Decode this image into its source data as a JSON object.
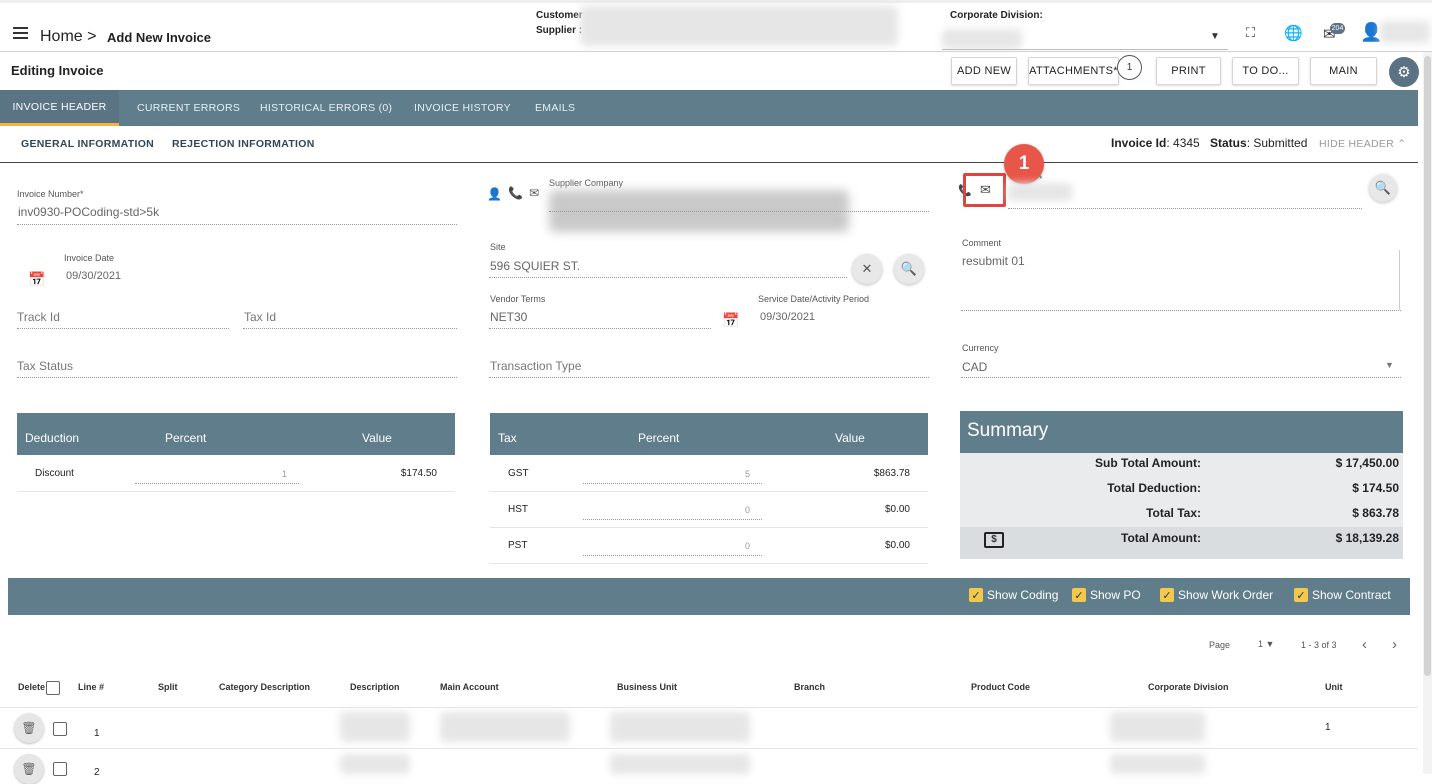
{
  "header": {
    "home": "Home >",
    "page": "Add New Invoice",
    "customer_label": "Customer",
    "supplier_label": "Supplier :",
    "corporate_division_label": "Corporate Division:",
    "notification_count": "204"
  },
  "toolbar": {
    "title": "Editing Invoice",
    "buttons": [
      "ADD NEW",
      "ATTACHMENTS*",
      "PRINT",
      "TO DO...",
      "MAIN"
    ],
    "attachments_count": "1"
  },
  "tabs": [
    "INVOICE HEADER",
    "CURRENT ERRORS",
    "HISTORICAL ERRORS (0)",
    "INVOICE HISTORY",
    "EMAILS"
  ],
  "subtabs": [
    "GENERAL INFORMATION",
    "REJECTION INFORMATION"
  ],
  "invoice_meta": {
    "id_label": "Invoice Id",
    "id_value": ": 4345",
    "status_label": "Status",
    "status_value": ": Submitted",
    "hide_header": "HIDE HEADER"
  },
  "form": {
    "invoice_number_label": "Invoice Number*",
    "invoice_number": "inv0930-POCoding-std>5k",
    "invoice_date_label": "Invoice Date",
    "invoice_date": "09/30/2021",
    "track_id_ph": "Track Id",
    "tax_id_ph": "Tax Id",
    "tax_status_ph": "Tax Status",
    "supplier_company_label": "Supplier Company",
    "site_label": "Site",
    "site_value": "596 SQUIER ST.",
    "vendor_terms_label": "Vendor Terms",
    "vendor_terms": "NET30",
    "service_date_label": "Service Date/Activity Period",
    "service_date": "09/30/2021",
    "transaction_type_ph": "Transaction Type",
    "comment_label": "Comment",
    "comment": "resubmit 01",
    "currency_label": "Currency",
    "currency": "CAD",
    "email_label_partial": "*"
  },
  "deductions": {
    "headers": [
      "Deduction",
      "Percent",
      "Value"
    ],
    "rows": [
      {
        "name": "Discount",
        "percent": "1",
        "value": "$174.50"
      }
    ]
  },
  "taxes": {
    "headers": [
      "Tax",
      "Percent",
      "Value"
    ],
    "rows": [
      {
        "name": "GST",
        "percent": "5",
        "value": "$863.78"
      },
      {
        "name": "HST",
        "percent": "0",
        "value": "$0.00"
      },
      {
        "name": "PST",
        "percent": "0",
        "value": "$0.00"
      }
    ]
  },
  "summary": {
    "title": "Summary",
    "rows": [
      {
        "label": "Sub Total Amount:",
        "value": "$ 17,450.00"
      },
      {
        "label": "Total Deduction:",
        "value": "$ 174.50"
      },
      {
        "label": "Total Tax:",
        "value": "$ 863.78"
      },
      {
        "label": "Total Amount:",
        "value": "$ 18,139.28"
      }
    ]
  },
  "options": [
    "Show Coding",
    "Show PO",
    "Show Work Order",
    "Show Contract"
  ],
  "pagination": {
    "page_label": "Page",
    "page": "1",
    "range": "1 - 3 of 3"
  },
  "lines": {
    "columns": [
      "Delete",
      "Line #",
      "Split",
      "Category Description",
      "Description",
      "Main Account",
      "Business Unit",
      "Branch",
      "Product Code",
      "Corporate Division",
      "Unit"
    ],
    "rows": [
      {
        "line": "1",
        "unit": "1"
      },
      {
        "line": "2",
        "unit": ""
      }
    ]
  },
  "callout": "1"
}
